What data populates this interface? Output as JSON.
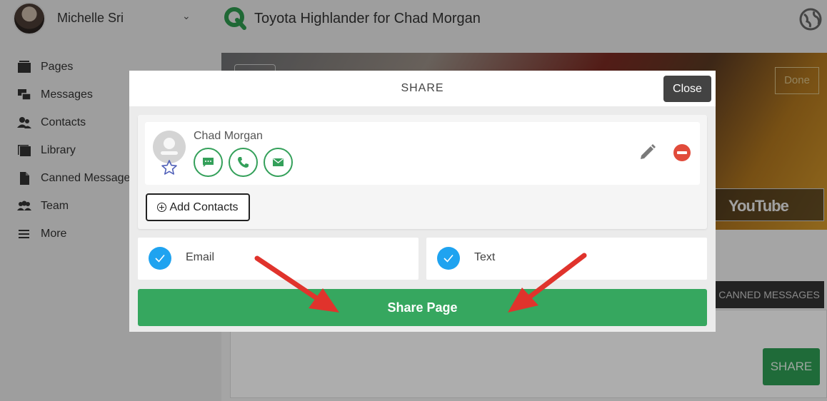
{
  "header": {
    "user_name": "Michelle Sri",
    "app_title": "Toyota Highlander for Chad Morgan"
  },
  "sidebar": {
    "items": [
      {
        "label": "Pages",
        "icon": "pages-icon"
      },
      {
        "label": "Messages",
        "icon": "messages-icon"
      },
      {
        "label": "Contacts",
        "icon": "contacts-icon"
      },
      {
        "label": "Library",
        "icon": "library-icon"
      },
      {
        "label": "Canned Messages",
        "icon": "document-icon"
      },
      {
        "label": "Team",
        "icon": "team-icon"
      },
      {
        "label": "More",
        "icon": "menu-icon"
      }
    ]
  },
  "background": {
    "done_label": "Done",
    "youtube_label": "YouTube",
    "canned_tab_label": "CANNED MESSAGES",
    "share_label": "SHARE"
  },
  "modal": {
    "title": "SHARE",
    "close_label": "Close",
    "contact": {
      "name": "Chad Morgan"
    },
    "add_contacts_label": "Add Contacts",
    "options": [
      {
        "label": "Email",
        "checked": true
      },
      {
        "label": "Text",
        "checked": true
      }
    ],
    "share_page_label": "Share Page"
  },
  "colors": {
    "accent_green": "#36a75f",
    "check_blue": "#1fa3f0",
    "remove_red": "#e14b3b",
    "arrow_red": "#e0332c"
  }
}
